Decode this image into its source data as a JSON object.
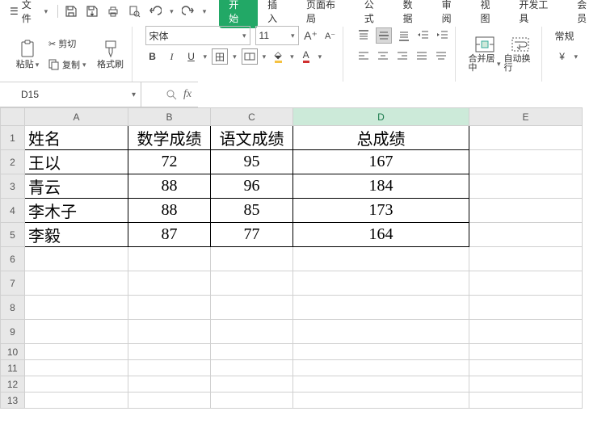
{
  "menubar": {
    "file_label": "文件",
    "tabs": [
      "开始",
      "插入",
      "页面布局",
      "公式",
      "数据",
      "审阅",
      "视图",
      "开发工具",
      "会员"
    ],
    "active_tab_index": 0
  },
  "ribbon": {
    "paste_label": "粘贴",
    "cut_label": "剪切",
    "copy_label": "复制",
    "format_painter_label": "格式刷",
    "font_name": "宋体",
    "font_size": "11",
    "merge_center_label": "合并居中",
    "wrap_text_label": "自动换行",
    "format_label": "常规"
  },
  "namebox": {
    "value": "D15"
  },
  "formula_bar": {
    "fx_label": "fx",
    "value": ""
  },
  "grid": {
    "columns": [
      "A",
      "B",
      "C",
      "D",
      "E"
    ],
    "active_col_index": 3,
    "rows_large": [
      1,
      2,
      3,
      4,
      5,
      6,
      7,
      8,
      9
    ],
    "rows_small": [
      10,
      11,
      12,
      13
    ],
    "data": {
      "headers": [
        "姓名",
        "数学成绩",
        "语文成绩",
        "总成绩"
      ],
      "rows": [
        {
          "name": "王以",
          "math": "72",
          "chinese": "95",
          "total": "167"
        },
        {
          "name": "青云",
          "math": "88",
          "chinese": "96",
          "total": "184"
        },
        {
          "name": "李木子",
          "math": "88",
          "chinese": "85",
          "total": "173"
        },
        {
          "name": "李毅",
          "math": "87",
          "chinese": "77",
          "total": "164"
        }
      ]
    }
  },
  "chart_data": {
    "type": "table",
    "columns": [
      "姓名",
      "数学成绩",
      "语文成绩",
      "总成绩"
    ],
    "rows": [
      [
        "王以",
        72,
        95,
        167
      ],
      [
        "青云",
        88,
        96,
        184
      ],
      [
        "李木子",
        88,
        85,
        173
      ],
      [
        "李毅",
        87,
        77,
        164
      ]
    ]
  }
}
